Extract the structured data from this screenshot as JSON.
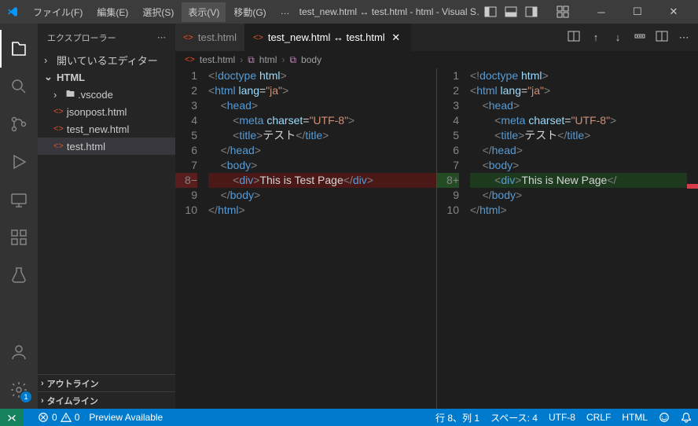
{
  "titlebar": {
    "menus": [
      "ファイル(F)",
      "編集(E)",
      "選択(S)",
      "表示(V)",
      "移動(G)",
      "…"
    ],
    "active_menu_index": 3,
    "title": "test_new.html ↔ test.html - html - Visual S…"
  },
  "sidebar": {
    "title": "エクスプローラー",
    "sections": {
      "open_editors": "開いているエディター",
      "workspace": "HTML",
      "outline": "アウトライン",
      "timeline": "タイムライン"
    },
    "tree": [
      {
        "label": ".vscode",
        "type": "folder",
        "indent": 1
      },
      {
        "label": "jsonpost.html",
        "type": "file",
        "indent": 1
      },
      {
        "label": "test_new.html",
        "type": "file",
        "indent": 1
      },
      {
        "label": "test.html",
        "type": "file",
        "indent": 1,
        "selected": true
      }
    ]
  },
  "tabs": [
    {
      "label": "test.html",
      "active": false
    },
    {
      "label": "test_new.html ↔ test.html",
      "active": true
    }
  ],
  "breadcrumb": [
    "test.html",
    "html",
    "body"
  ],
  "code_left": {
    "lines": [
      {
        "n": "1",
        "cls": "",
        "html": [
          [
            "br",
            "<!"
          ],
          [
            "doctype",
            "doctype"
          ],
          [
            "txt",
            " "
          ],
          [
            "doctype2",
            "html"
          ],
          [
            "br",
            ">"
          ]
        ]
      },
      {
        "n": "2",
        "cls": "",
        "html": [
          [
            "br",
            "<"
          ],
          [
            "tag",
            "html"
          ],
          [
            "txt",
            " "
          ],
          [
            "attr",
            "lang"
          ],
          [
            "txt",
            "="
          ],
          [
            "str",
            "\"ja\""
          ],
          [
            "br",
            ">"
          ]
        ]
      },
      {
        "n": "3",
        "cls": "",
        "html": [
          [
            "txt",
            "    "
          ],
          [
            "br",
            "<"
          ],
          [
            "tag",
            "head"
          ],
          [
            "br",
            ">"
          ]
        ]
      },
      {
        "n": "4",
        "cls": "",
        "html": [
          [
            "txt",
            "        "
          ],
          [
            "br",
            "<"
          ],
          [
            "tag",
            "meta"
          ],
          [
            "txt",
            " "
          ],
          [
            "attr",
            "charset"
          ],
          [
            "txt",
            "="
          ],
          [
            "str",
            "\"UTF-8\""
          ],
          [
            "br",
            ">"
          ]
        ]
      },
      {
        "n": "5",
        "cls": "",
        "html": [
          [
            "txt",
            "        "
          ],
          [
            "br",
            "<"
          ],
          [
            "tag",
            "title"
          ],
          [
            "br",
            ">"
          ],
          [
            "txt",
            "テスト"
          ],
          [
            "br",
            "</"
          ],
          [
            "tag",
            "title"
          ],
          [
            "br",
            ">"
          ]
        ]
      },
      {
        "n": "6",
        "cls": "",
        "html": [
          [
            "txt",
            "    "
          ],
          [
            "br",
            "</"
          ],
          [
            "tag",
            "head"
          ],
          [
            "br",
            ">"
          ]
        ]
      },
      {
        "n": "7",
        "cls": "",
        "html": [
          [
            "txt",
            "    "
          ],
          [
            "br",
            "<"
          ],
          [
            "tag",
            "body"
          ],
          [
            "br",
            ">"
          ]
        ]
      },
      {
        "n": "8−",
        "cls": "line-del",
        "html": [
          [
            "txt",
            "        "
          ],
          [
            "br",
            "<"
          ],
          [
            "tag",
            "div"
          ],
          [
            "br",
            ">"
          ],
          [
            "txt",
            "This is Test Page"
          ],
          [
            "br",
            "</"
          ],
          [
            "tag",
            "div"
          ],
          [
            "br",
            ">"
          ]
        ]
      },
      {
        "n": "9",
        "cls": "",
        "html": [
          [
            "txt",
            "    "
          ],
          [
            "br",
            "</"
          ],
          [
            "tag",
            "body"
          ],
          [
            "br",
            ">"
          ]
        ]
      },
      {
        "n": "10",
        "cls": "",
        "html": [
          [
            "br",
            "</"
          ],
          [
            "tag",
            "html"
          ],
          [
            "br",
            ">"
          ]
        ]
      }
    ]
  },
  "code_right": {
    "lines": [
      {
        "n": "1",
        "cls": "",
        "html": [
          [
            "br",
            "<!"
          ],
          [
            "doctype",
            "doctype"
          ],
          [
            "txt",
            " "
          ],
          [
            "doctype2",
            "html"
          ],
          [
            "br",
            ">"
          ]
        ]
      },
      {
        "n": "2",
        "cls": "",
        "html": [
          [
            "br",
            "<"
          ],
          [
            "tag",
            "html"
          ],
          [
            "txt",
            " "
          ],
          [
            "attr",
            "lang"
          ],
          [
            "txt",
            "="
          ],
          [
            "str",
            "\"ja\""
          ],
          [
            "br",
            ">"
          ]
        ]
      },
      {
        "n": "3",
        "cls": "",
        "html": [
          [
            "txt",
            "    "
          ],
          [
            "br",
            "<"
          ],
          [
            "tag",
            "head"
          ],
          [
            "br",
            ">"
          ]
        ]
      },
      {
        "n": "4",
        "cls": "",
        "html": [
          [
            "txt",
            "        "
          ],
          [
            "br",
            "<"
          ],
          [
            "tag",
            "meta"
          ],
          [
            "txt",
            " "
          ],
          [
            "attr",
            "charset"
          ],
          [
            "txt",
            "="
          ],
          [
            "str",
            "\"UTF-8\""
          ],
          [
            "br",
            ">"
          ]
        ]
      },
      {
        "n": "5",
        "cls": "",
        "html": [
          [
            "txt",
            "        "
          ],
          [
            "br",
            "<"
          ],
          [
            "tag",
            "title"
          ],
          [
            "br",
            ">"
          ],
          [
            "txt",
            "テスト"
          ],
          [
            "br",
            "</"
          ],
          [
            "tag",
            "title"
          ],
          [
            "br",
            ">"
          ]
        ]
      },
      {
        "n": "6",
        "cls": "",
        "html": [
          [
            "txt",
            "    "
          ],
          [
            "br",
            "</"
          ],
          [
            "tag",
            "head"
          ],
          [
            "br",
            ">"
          ]
        ]
      },
      {
        "n": "7",
        "cls": "",
        "html": [
          [
            "txt",
            "    "
          ],
          [
            "br",
            "<"
          ],
          [
            "tag",
            "body"
          ],
          [
            "br",
            ">"
          ]
        ]
      },
      {
        "n": "8+",
        "cls": "line-add",
        "html": [
          [
            "txt",
            "        "
          ],
          [
            "br",
            "<"
          ],
          [
            "tag",
            "div"
          ],
          [
            "br",
            ">"
          ],
          [
            "txt",
            "This is New Page"
          ],
          [
            "br",
            "</"
          ]
        ]
      },
      {
        "n": "9",
        "cls": "",
        "html": [
          [
            "txt",
            "    "
          ],
          [
            "br",
            "</"
          ],
          [
            "tag",
            "body"
          ],
          [
            "br",
            ">"
          ]
        ]
      },
      {
        "n": "10",
        "cls": "",
        "html": [
          [
            "br",
            "</"
          ],
          [
            "tag",
            "html"
          ],
          [
            "br",
            ">"
          ]
        ]
      }
    ]
  },
  "statusbar": {
    "errors": "0",
    "warnings": "0",
    "preview": "Preview Available",
    "cursor": "行 8、列 1",
    "spaces": "スペース: 4",
    "encoding": "UTF-8",
    "eol": "CRLF",
    "lang": "HTML"
  },
  "settings_badge": "1"
}
